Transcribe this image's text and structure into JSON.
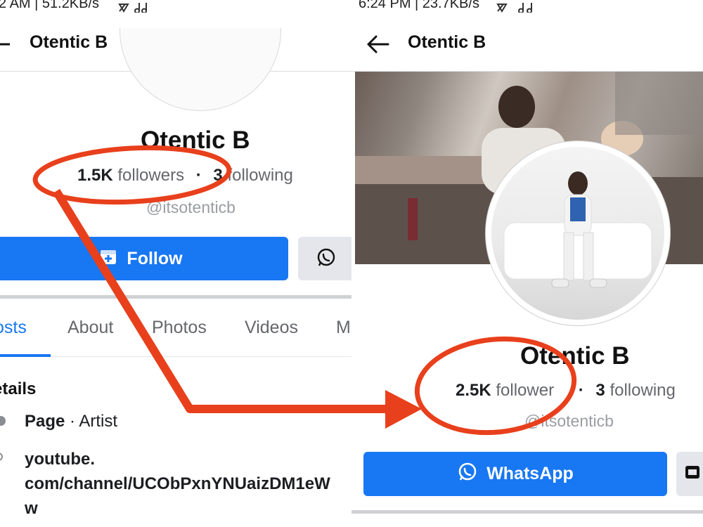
{
  "left": {
    "status_text": "2 AM | 51.2KB/s",
    "header_title": "Otentic B",
    "profile": {
      "name": "Otentic B",
      "followers_count": "1.5K",
      "followers_label": "followers",
      "separator": "·",
      "following_count": "3",
      "following_label": "following",
      "handle": "@itsotenticb"
    },
    "follow_label": "Follow",
    "tabs": [
      "osts",
      "About",
      "Photos",
      "Videos",
      "M"
    ],
    "details_heading": "etails",
    "details": {
      "category_strong": "Page",
      "category_rest": "· Artist",
      "link_line1": "youtube.",
      "link_line2": "com/channel/UCObPxnYNUaizDM1eW",
      "link_line3": "w"
    }
  },
  "right": {
    "status_text": "6:24 PM | 23.7KB/s",
    "header_title": "Otentic B",
    "profile": {
      "name": "Otentic B",
      "followers_count": "2.5K",
      "followers_label": "follower",
      "separator": "·",
      "following_count": "3",
      "following_label": "following",
      "handle": "@itsotenticb"
    },
    "whatsapp_label": "WhatsApp"
  },
  "colors": {
    "accent": "#1877f2",
    "annotation": "#e8401c",
    "secondary_button": "#e4e6eb"
  },
  "icons": [
    "back-arrow-icon",
    "whatsapp-icon",
    "messenger-icon",
    "page-icon",
    "link-icon"
  ]
}
